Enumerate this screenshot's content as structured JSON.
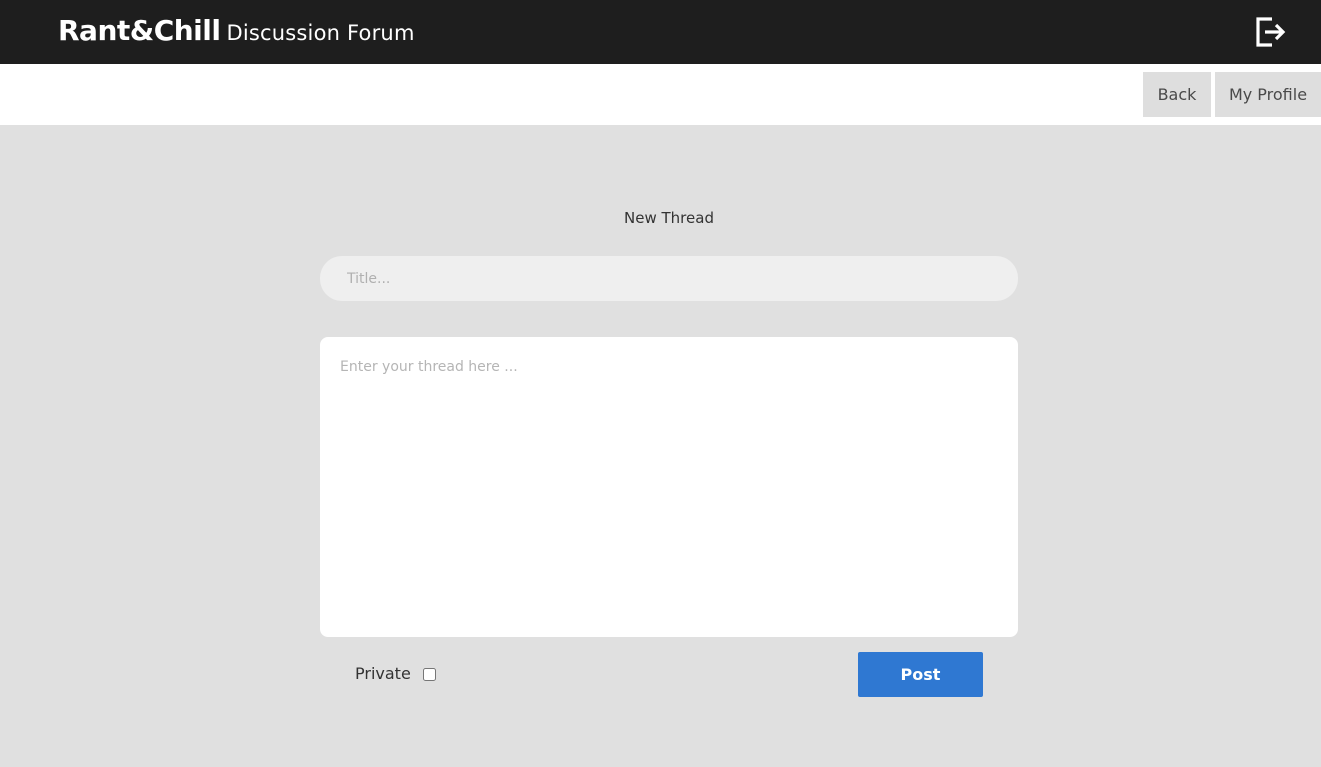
{
  "header": {
    "brand_strong": "Rant&Chill",
    "brand_sub": "Discussion Forum",
    "logout_icon": "logout-icon"
  },
  "nav": {
    "back_label": "Back",
    "profile_label": "My Profile"
  },
  "form": {
    "title": "New Thread",
    "title_placeholder": "Title...",
    "body_placeholder": "Enter your thread here ...",
    "private_label": "Private",
    "private_checked": false,
    "post_label": "Post"
  },
  "colors": {
    "header_bg": "#1e1e1e",
    "page_bg": "#e0e0e0",
    "accent": "#2f78d2"
  }
}
